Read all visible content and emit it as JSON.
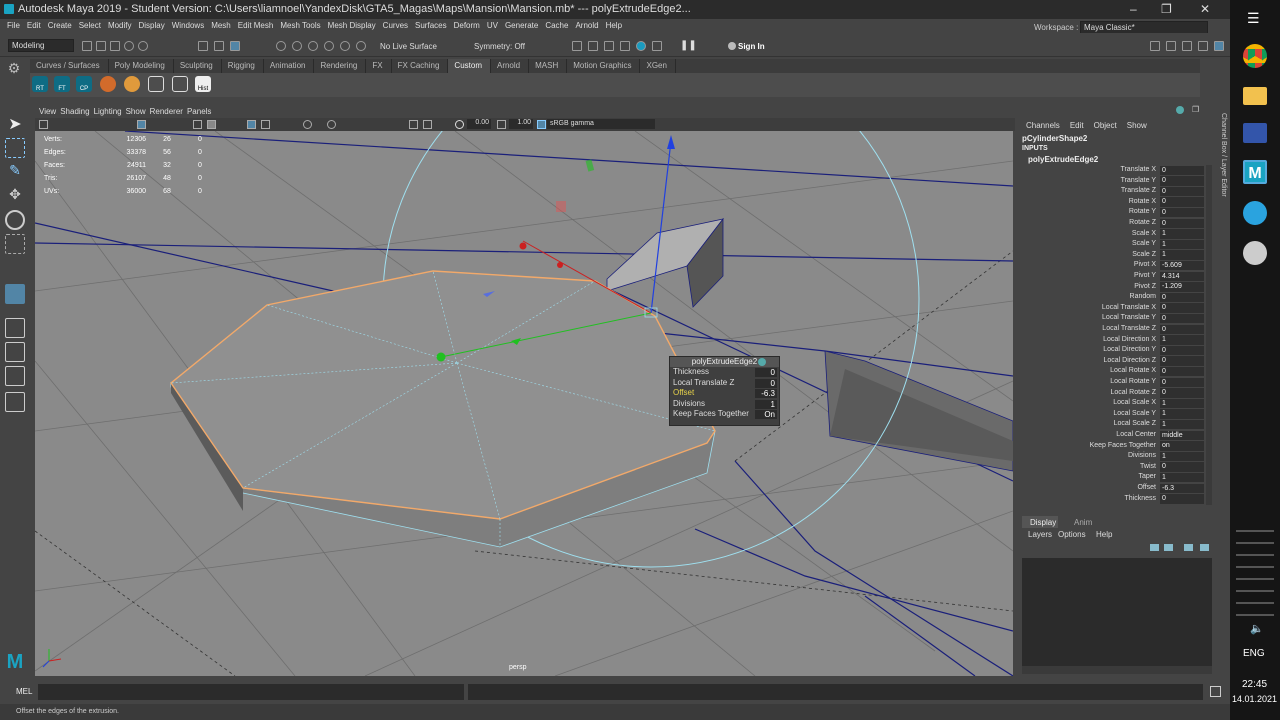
{
  "title": "Autodesk Maya 2019 - Student Version: C:\\Users\\liamnoel\\YandexDisk\\GTA5_Magas\\Maps\\Mansion\\Mansion.mb*   ---   polyExtrudeEdge2...",
  "workspace": {
    "label": "Workspace :",
    "value": "Maya Classic*"
  },
  "menus": [
    "File",
    "Edit",
    "Create",
    "Select",
    "Modify",
    "Display",
    "Windows",
    "Mesh",
    "Edit Mesh",
    "Mesh Tools",
    "Mesh Display",
    "Curves",
    "Surfaces",
    "Deform",
    "UV",
    "Generate",
    "Cache",
    "Arnold",
    "Help"
  ],
  "status": {
    "mode": "Modeling",
    "live_surface": "No Live Surface",
    "symmetry": "Symmetry: Off",
    "sign_in": "Sign In"
  },
  "shelf_tabs": [
    "Curves / Surfaces",
    "Poly Modeling",
    "Sculpting",
    "Rigging",
    "Animation",
    "Rendering",
    "FX",
    "FX Caching",
    "Custom",
    "Arnold",
    "MASH",
    "Motion Graphics",
    "XGen"
  ],
  "shelf_active": "Custom",
  "shelf_buttons": [
    "RT",
    "FT",
    "CP",
    "",
    "",
    "",
    "",
    "Hist"
  ],
  "viewport_menu": [
    "View",
    "Shading",
    "Lighting",
    "Show",
    "Renderer",
    "Panels"
  ],
  "viewport_toolbar": {
    "val1": "0.00",
    "val2": "1.00",
    "color_space": "sRGB gamma"
  },
  "hud": [
    {
      "label": "Verts:",
      "a": "12306",
      "b": "26",
      "c": "0"
    },
    {
      "label": "Edges:",
      "a": "33378",
      "b": "56",
      "c": "0"
    },
    {
      "label": "Faces:",
      "a": "24911",
      "b": "32",
      "c": "0"
    },
    {
      "label": "Tris:",
      "a": "26107",
      "b": "48",
      "c": "0"
    },
    {
      "label": "UVs:",
      "a": "36000",
      "b": "68",
      "c": "0"
    }
  ],
  "camera_label": "persp",
  "popup": {
    "title": "polyExtrudeEdge2",
    "rows": [
      {
        "label": "Thickness",
        "value": "0",
        "hl": false
      },
      {
        "label": "Local Translate Z",
        "value": "0",
        "hl": false
      },
      {
        "label": "Offset",
        "value": "-6.3",
        "hl": true
      },
      {
        "label": "Divisions",
        "value": "1",
        "hl": false
      },
      {
        "label": "Keep Faces Together",
        "value": "On",
        "hl": false
      }
    ]
  },
  "channel_box": {
    "menu": [
      "Channels",
      "Edit",
      "Object",
      "Show"
    ],
    "shape": "pCylinderShape2",
    "inputs": "INPUTS",
    "node": "polyExtrudeEdge2",
    "attrs": [
      {
        "n": "Translate X",
        "v": "0"
      },
      {
        "n": "Translate Y",
        "v": "0"
      },
      {
        "n": "Translate Z",
        "v": "0"
      },
      {
        "n": "Rotate X",
        "v": "0"
      },
      {
        "n": "Rotate Y",
        "v": "0"
      },
      {
        "n": "Rotate Z",
        "v": "0"
      },
      {
        "n": "Scale X",
        "v": "1"
      },
      {
        "n": "Scale Y",
        "v": "1"
      },
      {
        "n": "Scale Z",
        "v": "1"
      },
      {
        "n": "Pivot X",
        "v": "-5.609"
      },
      {
        "n": "Pivot Y",
        "v": "4.314"
      },
      {
        "n": "Pivot Z",
        "v": "-1.209"
      },
      {
        "n": "Random",
        "v": "0"
      },
      {
        "n": "Local Translate X",
        "v": "0"
      },
      {
        "n": "Local Translate Y",
        "v": "0"
      },
      {
        "n": "Local Translate Z",
        "v": "0"
      },
      {
        "n": "Local Direction X",
        "v": "1"
      },
      {
        "n": "Local Direction Y",
        "v": "0"
      },
      {
        "n": "Local Direction Z",
        "v": "0"
      },
      {
        "n": "Local Rotate X",
        "v": "0"
      },
      {
        "n": "Local Rotate Y",
        "v": "0"
      },
      {
        "n": "Local Rotate Z",
        "v": "0"
      },
      {
        "n": "Local Scale X",
        "v": "1"
      },
      {
        "n": "Local Scale Y",
        "v": "1"
      },
      {
        "n": "Local Scale Z",
        "v": "1"
      },
      {
        "n": "Local Center",
        "v": "middle"
      },
      {
        "n": "Keep Faces Together",
        "v": "on"
      },
      {
        "n": "Divisions",
        "v": "1"
      },
      {
        "n": "Twist",
        "v": "0"
      },
      {
        "n": "Taper",
        "v": "1"
      },
      {
        "n": "Offset",
        "v": "-6.3"
      },
      {
        "n": "Thickness",
        "v": "0"
      }
    ],
    "side_label": "Channel Box / Layer Editor"
  },
  "layer_editor": {
    "tabs": [
      "Display",
      "Anim"
    ],
    "menu": [
      "Layers",
      "Options",
      "Help"
    ]
  },
  "mel_label": "MEL",
  "help_line": "Offset the edges of the extrusion.",
  "taskbar": {
    "lang": "ENG",
    "time": "22:45",
    "date": "14.01.2021"
  },
  "colors": {
    "selection": "#f2a96a",
    "manip_x": "#cc2020",
    "manip_y": "#20c020",
    "manip_z": "#2040e0",
    "wire": "#9fe0f0"
  }
}
